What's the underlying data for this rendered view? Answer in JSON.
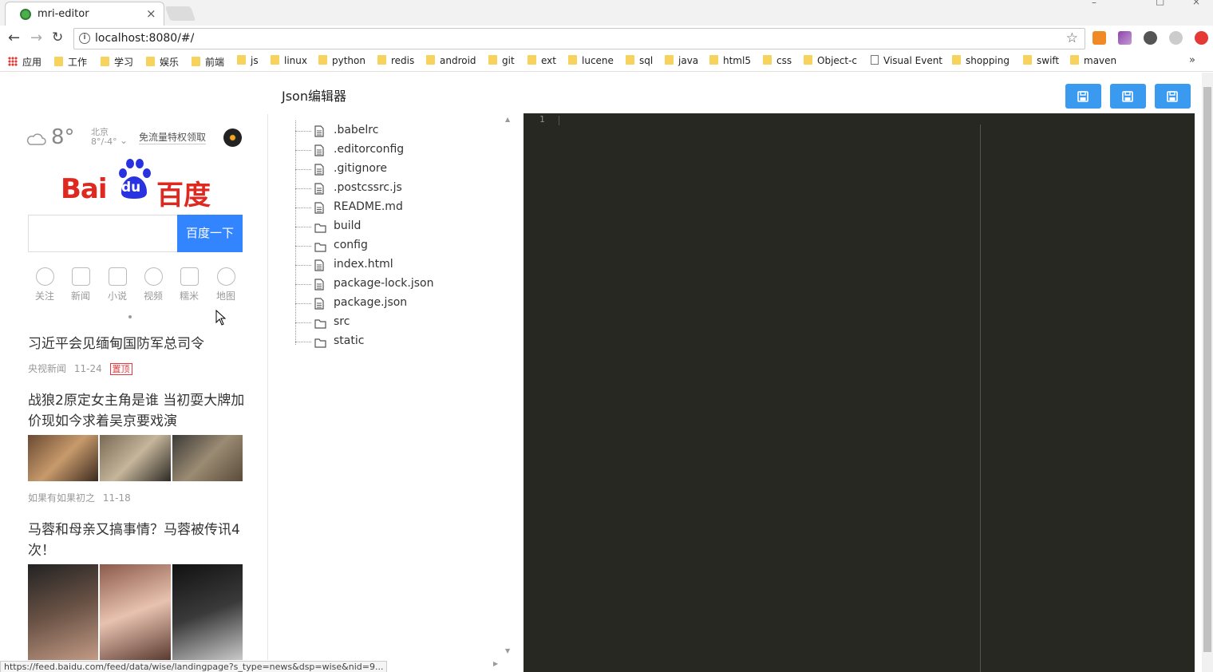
{
  "browser": {
    "tab_title": "mri-editor",
    "tab_close": "×",
    "url": "localhost:8080/#/",
    "window_controls": [
      "–",
      "□",
      "×"
    ],
    "bookmarks": [
      {
        "label": "应用",
        "type": "apps"
      },
      {
        "label": "工作",
        "type": "folder"
      },
      {
        "label": "学习",
        "type": "folder"
      },
      {
        "label": "娱乐",
        "type": "folder"
      },
      {
        "label": "前端",
        "type": "folder"
      },
      {
        "label": "js",
        "type": "folder"
      },
      {
        "label": "linux",
        "type": "folder"
      },
      {
        "label": "python",
        "type": "folder"
      },
      {
        "label": "redis",
        "type": "folder"
      },
      {
        "label": "android",
        "type": "folder"
      },
      {
        "label": "git",
        "type": "folder"
      },
      {
        "label": "ext",
        "type": "folder"
      },
      {
        "label": "lucene",
        "type": "folder"
      },
      {
        "label": "sql",
        "type": "folder"
      },
      {
        "label": "java",
        "type": "folder"
      },
      {
        "label": "html5",
        "type": "folder"
      },
      {
        "label": "css",
        "type": "folder"
      },
      {
        "label": "Object-c",
        "type": "folder"
      },
      {
        "label": "Visual Event",
        "type": "page"
      },
      {
        "label": "shopping",
        "type": "folder"
      },
      {
        "label": "swift",
        "type": "folder"
      },
      {
        "label": "maven",
        "type": "folder"
      }
    ],
    "more_bookmarks": "»",
    "status_url": "https://feed.baidu.com/feed/data/wise/landingpage?s_type=news&dsp=wise&nid=9..."
  },
  "app": {
    "title": "Json编辑器",
    "save_buttons": [
      "save-icon",
      "save-icon",
      "save-icon"
    ]
  },
  "preview": {
    "weather": {
      "temp": "8°",
      "city": "北京",
      "range": "8°/-4°"
    },
    "promo": "免流量特权领取",
    "logo": {
      "left": "Bai",
      "middle": "du",
      "right": "百度"
    },
    "search_button": "百度一下",
    "quick_links": [
      "关注",
      "新闻",
      "小说",
      "视频",
      "糯米",
      "地图"
    ],
    "news": [
      {
        "title": "习近平会见缅甸国防军总司令",
        "source": "央视新闻",
        "date": "11-24",
        "tag": "置顶"
      },
      {
        "title": "战狼2原定女主角是谁 当初耍大牌加价现如今求着吴京要戏演",
        "source": "如果有如果初之",
        "date": "11-18"
      },
      {
        "title": "马蓉和母亲又搞事情？马蓉被传讯4次！"
      }
    ]
  },
  "tree": {
    "items": [
      {
        "name": ".babelrc",
        "type": "file"
      },
      {
        "name": ".editorconfig",
        "type": "file"
      },
      {
        "name": ".gitignore",
        "type": "file"
      },
      {
        "name": ".postcssrc.js",
        "type": "file"
      },
      {
        "name": "README.md",
        "type": "file"
      },
      {
        "name": "build",
        "type": "folder"
      },
      {
        "name": "config",
        "type": "folder"
      },
      {
        "name": "index.html",
        "type": "file"
      },
      {
        "name": "package-lock.json",
        "type": "file"
      },
      {
        "name": "package.json",
        "type": "file"
      },
      {
        "name": "src",
        "type": "folder"
      },
      {
        "name": "static",
        "type": "folder"
      }
    ]
  },
  "editor": {
    "line_number": "1",
    "background": "#272822"
  },
  "colors": {
    "accent": "#3a9af0",
    "baidu_red": "#de2820",
    "baidu_blue": "#3385ff"
  }
}
